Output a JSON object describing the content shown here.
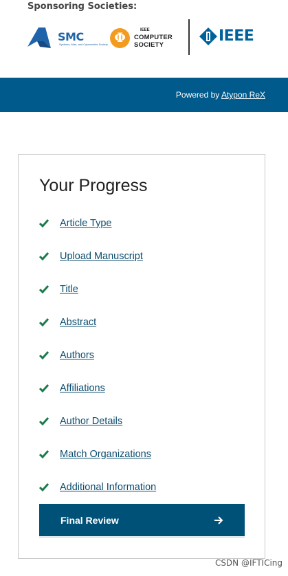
{
  "sponsors": {
    "title": "Sponsoring Societies:",
    "smc": {
      "name": "SMC",
      "subtitle": "Systems, Man, and Cybernetics Society"
    },
    "computer_society": {
      "symbol": "Φ",
      "line1": "IEEE",
      "line2": "COMPUTER",
      "line3": "SOCIETY"
    },
    "ieee": {
      "name": "IEEE"
    }
  },
  "powered_by": {
    "prefix": "Powered by ",
    "link_label": "Atypon ReX"
  },
  "progress": {
    "title": "Your Progress",
    "steps": [
      {
        "label": "Article Type",
        "status": "complete"
      },
      {
        "label": "Upload Manuscript",
        "status": "complete"
      },
      {
        "label": "Title",
        "status": "complete"
      },
      {
        "label": "Abstract",
        "status": "complete"
      },
      {
        "label": "Authors",
        "status": "complete"
      },
      {
        "label": "Affiliations",
        "status": "complete"
      },
      {
        "label": "Author Details",
        "status": "complete"
      },
      {
        "label": "Match Organizations",
        "status": "complete"
      },
      {
        "label": "Additional Information",
        "status": "complete"
      }
    ],
    "final_button_label": "Final Review"
  },
  "watermark": "CSDN @IFTICing",
  "colors": {
    "brand_blue": "#005a8c",
    "button_blue": "#005177",
    "check_green": "#1a7a4a",
    "link_color": "#0b4b6e",
    "cs_orange": "#f39b1f",
    "ieee_blue": "#00629b"
  },
  "icons": {
    "step_status": "check-icon",
    "final_button": "arrow-right-icon"
  }
}
